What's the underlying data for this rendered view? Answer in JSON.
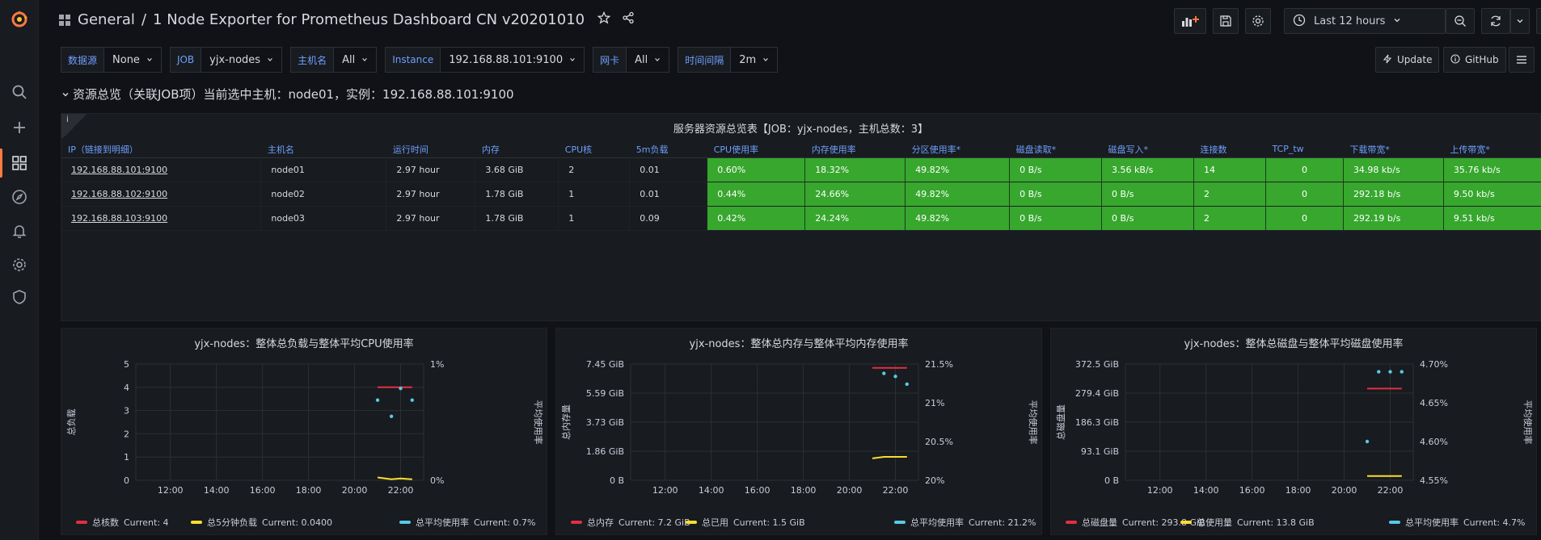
{
  "breadcrumb": {
    "folder": "General",
    "separator": "/",
    "dashboard": "1 Node Exporter for Prometheus Dashboard CN v20201010"
  },
  "time_picker": {
    "label": "Last 12 hours"
  },
  "variables": [
    {
      "label": "数据源",
      "value": "None"
    },
    {
      "label": "JOB",
      "value": "yjx-nodes"
    },
    {
      "label": "主机名",
      "value": "All"
    },
    {
      "label": "Instance",
      "value": "192.168.88.101:9100"
    },
    {
      "label": "网卡",
      "value": "All"
    },
    {
      "label": "时间间隔",
      "value": "2m"
    }
  ],
  "links": {
    "update": "Update",
    "github": "GitHub"
  },
  "row": {
    "title": "资源总览（关联JOB项）当前选中主机：node01，实例：192.168.88.101:9100"
  },
  "table": {
    "info_glyph": "i",
    "title": "服务器资源总览表【JOB：yjx-nodes，主机总数：3】",
    "columns": [
      "IP（链接到明细）",
      "主机名",
      "运行时间",
      "内存",
      "CPU核",
      "5m负载",
      "CPU使用率",
      "内存使用率",
      "分区使用率*",
      "磁盘读取*",
      "磁盘写入*",
      "连接数",
      "TCP_tw",
      "下载带宽*",
      "上传带宽*"
    ],
    "rows": [
      [
        "192.168.88.101:9100",
        "node01",
        "2.97 hour",
        "3.68 GiB",
        "2",
        "0.01",
        "0.60%",
        "18.32%",
        "49.82%",
        "0 B/s",
        "3.56 kB/s",
        "14",
        "0",
        "34.98 kb/s",
        "35.76 kb/s"
      ],
      [
        "192.168.88.102:9100",
        "node02",
        "2.97 hour",
        "1.78 GiB",
        "1",
        "0.01",
        "0.44%",
        "24.66%",
        "49.82%",
        "0 B/s",
        "0 B/s",
        "2",
        "0",
        "292.18 b/s",
        "9.50 kb/s"
      ],
      [
        "192.168.88.103:9100",
        "node03",
        "2.97 hour",
        "1.78 GiB",
        "1",
        "0.09",
        "0.42%",
        "24.24%",
        "49.82%",
        "0 B/s",
        "0 B/s",
        "2",
        "0",
        "292.19 b/s",
        "9.51 kb/s"
      ]
    ]
  },
  "colors": {
    "red": "#e02f44",
    "yellow": "#fade2a",
    "cyan": "#5ac8e6",
    "green": "#37a72e",
    "accent": "#ff7941"
  },
  "chart_data": [
    {
      "type": "line",
      "title": "yjx-nodes：整体总负载与整体平均CPU使用率",
      "x_ticks": [
        "12:00",
        "14:00",
        "16:00",
        "18:00",
        "20:00",
        "22:00"
      ],
      "ylabel_left": "总负载",
      "ylabel_right": "平均使用率",
      "y_left_ticks": [
        "5",
        "4",
        "3",
        "2",
        "1",
        "0"
      ],
      "y_right_ticks": [
        "1%",
        "0%"
      ],
      "ylim_left": [
        0,
        5
      ],
      "ylim_right": [
        0,
        1
      ],
      "series": [
        {
          "name": "总核数",
          "color": "#e02f44",
          "axis": "left",
          "points": [
            [
              21.0,
              4
            ],
            [
              22.5,
              4
            ]
          ],
          "current": "Current: 4"
        },
        {
          "name": "总5分钟负载",
          "color": "#fade2a",
          "axis": "left",
          "points": [
            [
              21.0,
              0.12
            ],
            [
              21.6,
              0.04
            ],
            [
              22.0,
              0.08
            ],
            [
              22.5,
              0.04
            ]
          ],
          "current": "Current: 0.0400"
        },
        {
          "name": "总平均使用率",
          "color": "#5ac8e6",
          "axis": "right",
          "style": "points",
          "points": [
            [
              21.0,
              0.69
            ],
            [
              21.6,
              0.55
            ],
            [
              22.0,
              0.79
            ],
            [
              22.5,
              0.69
            ]
          ],
          "current": "Current: 0.7%"
        }
      ]
    },
    {
      "type": "line",
      "title": "yjx-nodes：整体总内存与整体平均内存使用率",
      "x_ticks": [
        "12:00",
        "14:00",
        "16:00",
        "18:00",
        "20:00",
        "22:00"
      ],
      "ylabel_left": "总内存量",
      "ylabel_right": "平均使用率",
      "y_left_ticks": [
        "7.45 GiB",
        "5.59 GiB",
        "3.73 GiB",
        "1.86 GiB",
        "0 B"
      ],
      "y_right_ticks": [
        "21.5%",
        "21%",
        "20.5%",
        "20%"
      ],
      "ylim_left": [
        0,
        7.45
      ],
      "ylim_right": [
        20,
        21.5
      ],
      "series": [
        {
          "name": "总内存",
          "color": "#e02f44",
          "axis": "left",
          "points": [
            [
              21.0,
              7.2
            ],
            [
              22.5,
              7.2
            ]
          ],
          "current": "Current: 7.2 GiB"
        },
        {
          "name": "总已用",
          "color": "#fade2a",
          "axis": "left",
          "points": [
            [
              21.0,
              1.4
            ],
            [
              21.5,
              1.5
            ],
            [
              22.5,
              1.5
            ]
          ],
          "current": "Current: 1.5 GiB"
        },
        {
          "name": "总平均使用率",
          "color": "#5ac8e6",
          "axis": "right",
          "style": "points",
          "points": [
            [
              21.5,
              21.38
            ],
            [
              22.0,
              21.34
            ],
            [
              22.5,
              21.24
            ]
          ],
          "current": "Current: 21.2%"
        }
      ]
    },
    {
      "type": "line",
      "title": "yjx-nodes：整体总磁盘与整体平均磁盘使用率",
      "x_ticks": [
        "12:00",
        "14:00",
        "16:00",
        "18:00",
        "20:00",
        "22:00"
      ],
      "ylabel_left": "总磁盘量",
      "ylabel_right": "平均使用率",
      "y_left_ticks": [
        "372.5 GiB",
        "279.4 GiB",
        "186.3 GiB",
        "93.1 GiB",
        "0 B"
      ],
      "y_right_ticks": [
        "4.70%",
        "4.65%",
        "4.60%",
        "4.55%"
      ],
      "ylim_left": [
        0,
        372.5
      ],
      "ylim_right": [
        4.55,
        4.7
      ],
      "series": [
        {
          "name": "总磁盘量",
          "color": "#e02f44",
          "axis": "left",
          "points": [
            [
              21.0,
              293.8
            ],
            [
              22.5,
              293.8
            ]
          ],
          "current": "Current: 293.8 GiB"
        },
        {
          "name": "总使用量",
          "color": "#fade2a",
          "axis": "left",
          "points": [
            [
              21.0,
              13.8
            ],
            [
              22.5,
              13.8
            ]
          ],
          "current": "Current: 13.8 GiB"
        },
        {
          "name": "总平均使用率",
          "color": "#5ac8e6",
          "axis": "right",
          "style": "points",
          "points": [
            [
              21.0,
              4.6
            ],
            [
              21.5,
              4.69
            ],
            [
              22.0,
              4.69
            ],
            [
              22.5,
              4.69
            ]
          ],
          "current": "Current: 4.7%"
        }
      ]
    }
  ]
}
